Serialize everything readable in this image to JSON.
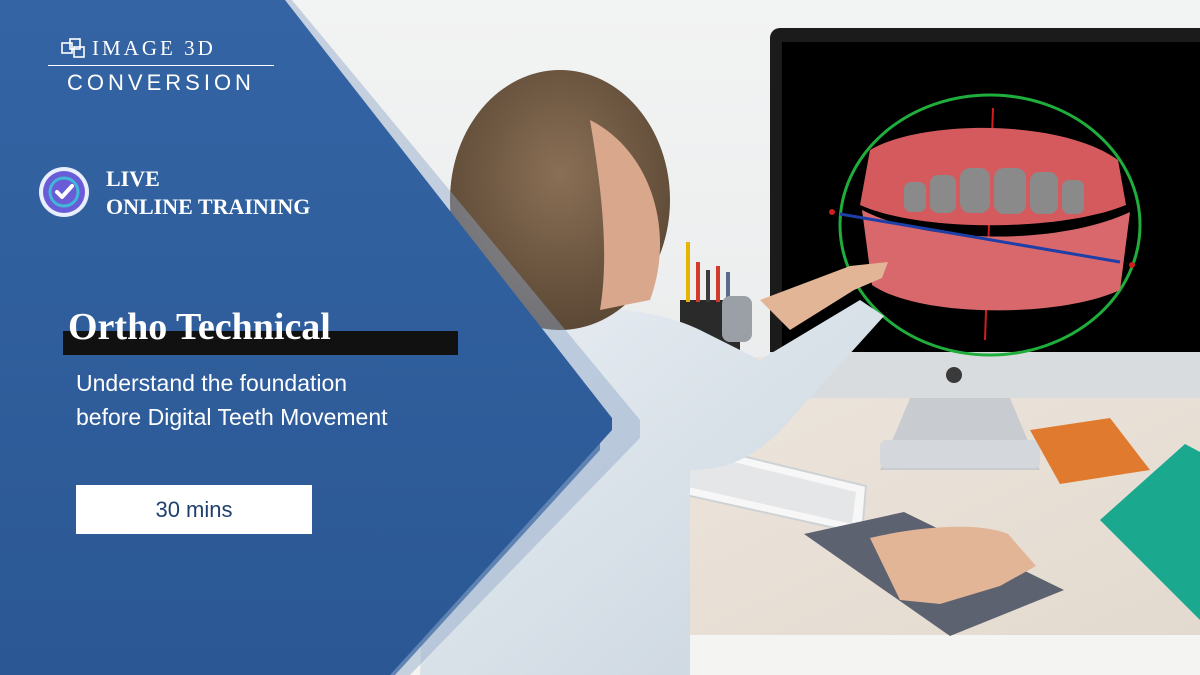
{
  "brand": {
    "name": "IMAGE 3D",
    "sub": "CONVERSION",
    "icon": "cube-logo-icon"
  },
  "badge": {
    "icon": "check-circle-badge-icon",
    "line1": "LIVE",
    "line2": "ONLINE TRAINING"
  },
  "course": {
    "title": "Ortho Technical",
    "subtitle_line1": "Understand the foundation",
    "subtitle_line2": "before Digital Teeth Movement",
    "duration": "30 mins"
  },
  "colors": {
    "panel_blue": "#2f5f9e",
    "title_bar": "#111111",
    "accent_teal": "#3fb8d8",
    "badge_purple": "#6a5cd6"
  }
}
